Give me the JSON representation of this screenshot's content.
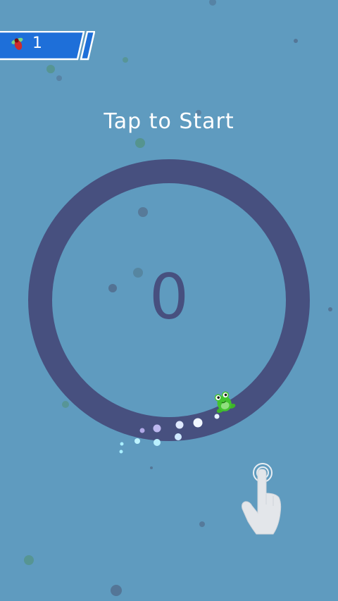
{
  "hud": {
    "fly_count": "1",
    "fly_icon": "fly-icon"
  },
  "overlay": {
    "title": "Tap to Start"
  },
  "game": {
    "score": "0",
    "player_icon": "frog-icon",
    "hint_icon": "tap-hand-icon"
  },
  "colors": {
    "background": "#5f9bbf",
    "ring": "#47507f",
    "hud_bar": "#1e6fd9",
    "hud_border": "#ffffff",
    "text": "#ffffff",
    "frog": "#43c42f"
  }
}
